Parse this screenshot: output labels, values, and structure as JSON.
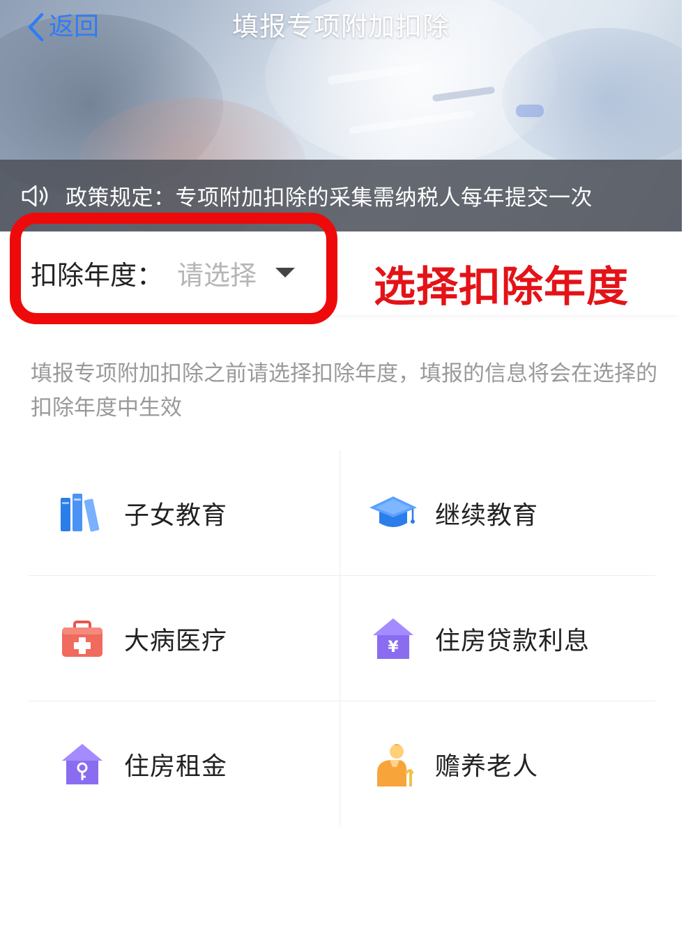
{
  "nav": {
    "back_label": "返回",
    "title": "填报专项附加扣除"
  },
  "notice": {
    "icon": "speaker-icon",
    "text": "政策规定：专项附加扣除的采集需纳税人每年提交一次"
  },
  "year_selector": {
    "label": "扣除年度：",
    "placeholder": "请选择",
    "caret_icon": "caret-down-icon"
  },
  "annotation": {
    "text": "选择扣除年度",
    "color": "#e31318"
  },
  "hint": "填报专项附加扣除之前请选择扣除年度，填报的信息将会在选择的扣除年度中生效",
  "categories": [
    {
      "label": "子女教育",
      "icon": "books-icon"
    },
    {
      "label": "继续教育",
      "icon": "graduation-cap-icon"
    },
    {
      "label": "大病医疗",
      "icon": "medical-kit-icon"
    },
    {
      "label": "住房贷款利息",
      "icon": "house-yuan-icon"
    },
    {
      "label": "住房租金",
      "icon": "house-key-icon"
    },
    {
      "label": "赡养老人",
      "icon": "elderly-person-icon"
    }
  ],
  "colors": {
    "accent": "#2f7cf6",
    "highlight": "#ee0a0a"
  }
}
